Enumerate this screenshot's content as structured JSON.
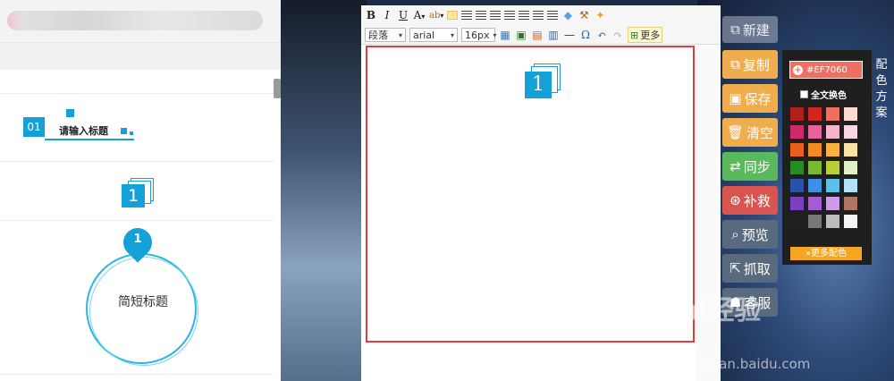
{
  "left_panel": {
    "template1": {
      "number": "01",
      "title": "请输入标题"
    },
    "template2": {
      "number": "1"
    },
    "template3": {
      "number": "1",
      "title": "简短标题"
    }
  },
  "toolbar": {
    "row1": [
      "B",
      "I",
      "U",
      "A",
      "ab"
    ],
    "paragraph": "段落",
    "font": "arial",
    "size": "16px",
    "more_label": "更多"
  },
  "canvas": {
    "number": "1"
  },
  "side": {
    "new": "新建",
    "copy": "复制",
    "save": "保存",
    "clear": "清空",
    "sync": "同步",
    "rescue": "补救",
    "preview": "预览",
    "grab": "抓取",
    "service": "客服",
    "colors": {
      "new": "#c3cad4",
      "copy": "#f0ad4e",
      "save": "#f0ad4e",
      "clear": "#f0ad4e",
      "sync": "#5cb85c",
      "rescue": "#d9534f",
      "preview": "#5a6a7e",
      "grab": "#5a6a7e",
      "service": "#5a6a7e"
    }
  },
  "color_panel": {
    "hex": "#EF7060",
    "all_swap_label": "全文换色",
    "more_label": "更多配色",
    "title": "配色方案",
    "swatches": [
      "#b11f1f",
      "#d3251f",
      "#ef7060",
      "#f9d9d2",
      "#d12a6c",
      "#e8619a",
      "#f5b3cd",
      "#f9d7e2",
      "#e8601c",
      "#f28c1f",
      "#f6b33d",
      "#fbe1a3",
      "#2a8a25",
      "#7cb830",
      "#b8cf3a",
      "#e3efc6",
      "#2a52a8",
      "#3c8fe4",
      "#5dbfea",
      "#b3e1f5",
      "#7b3fbf",
      "#a35cd4",
      "#cf9de6",
      "#b07565",
      "#202020",
      "#777777",
      "#bdbdbd",
      "#f4f4f4"
    ]
  },
  "watermark": {
    "brand": "Bai经验",
    "url": "jingyan.baidu.com"
  }
}
